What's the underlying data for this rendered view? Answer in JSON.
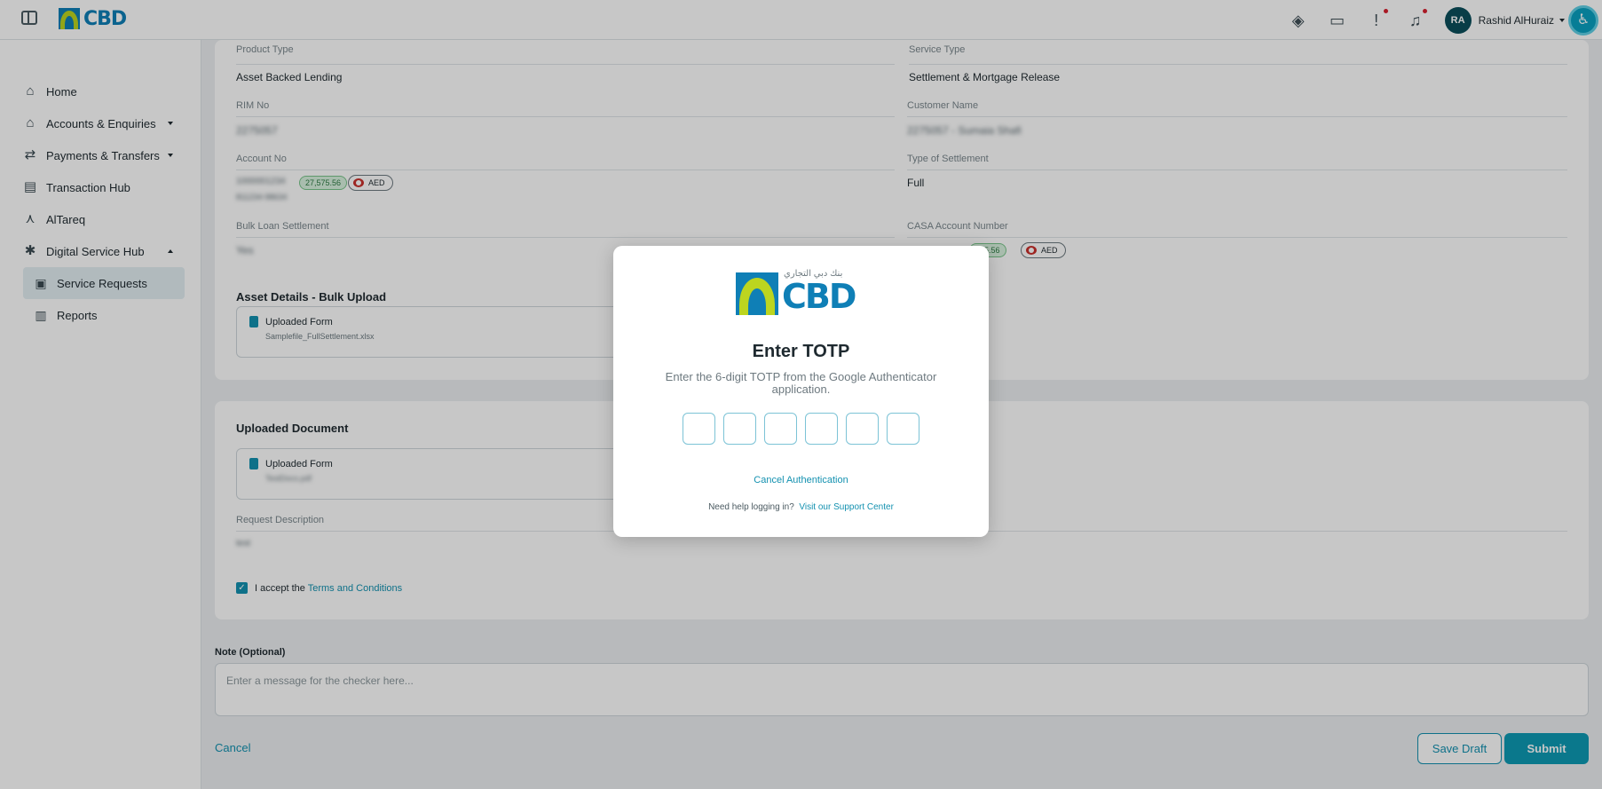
{
  "header": {
    "logo_text": "CBD",
    "user_initials": "RA",
    "user_name": "Rashid AlHuraiz"
  },
  "sidebar": {
    "items": [
      {
        "label": "Home",
        "icon": "home-icon"
      },
      {
        "label": "Accounts & Enquiries",
        "icon": "bank-icon"
      },
      {
        "label": "Payments & Transfers",
        "icon": "transfer-icon"
      },
      {
        "label": "Transaction Hub",
        "icon": "list-icon"
      },
      {
        "label": "AlTareq",
        "icon": "network-icon"
      },
      {
        "label": "Digital Service Hub",
        "icon": "hub-icon"
      }
    ],
    "sub_items": [
      {
        "label": "Service Requests",
        "icon": "briefcase-icon"
      },
      {
        "label": "Reports",
        "icon": "clipboard-icon"
      }
    ]
  },
  "form": {
    "product_type_label": "Product Type",
    "product_type_value": "Asset Backed Lending",
    "service_type_label": "Service Type",
    "service_type_value": "Settlement & Mortgage Release",
    "rim_label": "RIM No",
    "rim_value": "2275057",
    "customer_label": "Customer Name",
    "customer_value": "2275057 - Sumaia Shafi",
    "account_label": "Account No",
    "account_value": "1000001234",
    "account_sub": "811234-98634",
    "account_amount": "27,575.56",
    "account_currency": "AED",
    "settlement_type_label": "Type of Settlement",
    "settlement_type_value": "Full",
    "bulk_label": "Bulk Loan Settlement",
    "bulk_value": "Yes",
    "casa_label": "CASA Account Number",
    "casa_amount": "575.56",
    "casa_currency": "AED",
    "asset_section": "Asset Details - Bulk Upload",
    "asset_file_title": "Uploaded Form",
    "asset_file_name": "Samplefile_FullSettlement.xlsx",
    "doc_section": "Uploaded Document",
    "doc_file_title": "Uploaded Form",
    "doc_file_name": "TestDocs.pdf",
    "desc_label": "Request Description",
    "desc_value": "test",
    "accept_prefix": "I accept the",
    "accept_link": "Terms and Conditions"
  },
  "note": {
    "label": "Note (Optional)",
    "placeholder": "Enter a message for the checker here..."
  },
  "actions": {
    "cancel": "Cancel",
    "save_draft": "Save Draft",
    "submit": "Submit"
  },
  "modal": {
    "logo_text": "CBD",
    "arabic_text": "بنك دبي التجاري",
    "title": "Enter TOTP",
    "subtitle": "Enter the 6-digit TOTP from the Google Authenticator application.",
    "cancel_auth": "Cancel Authentication",
    "help_prefix": "Need help logging in?",
    "help_link": "Visit our Support Center"
  }
}
